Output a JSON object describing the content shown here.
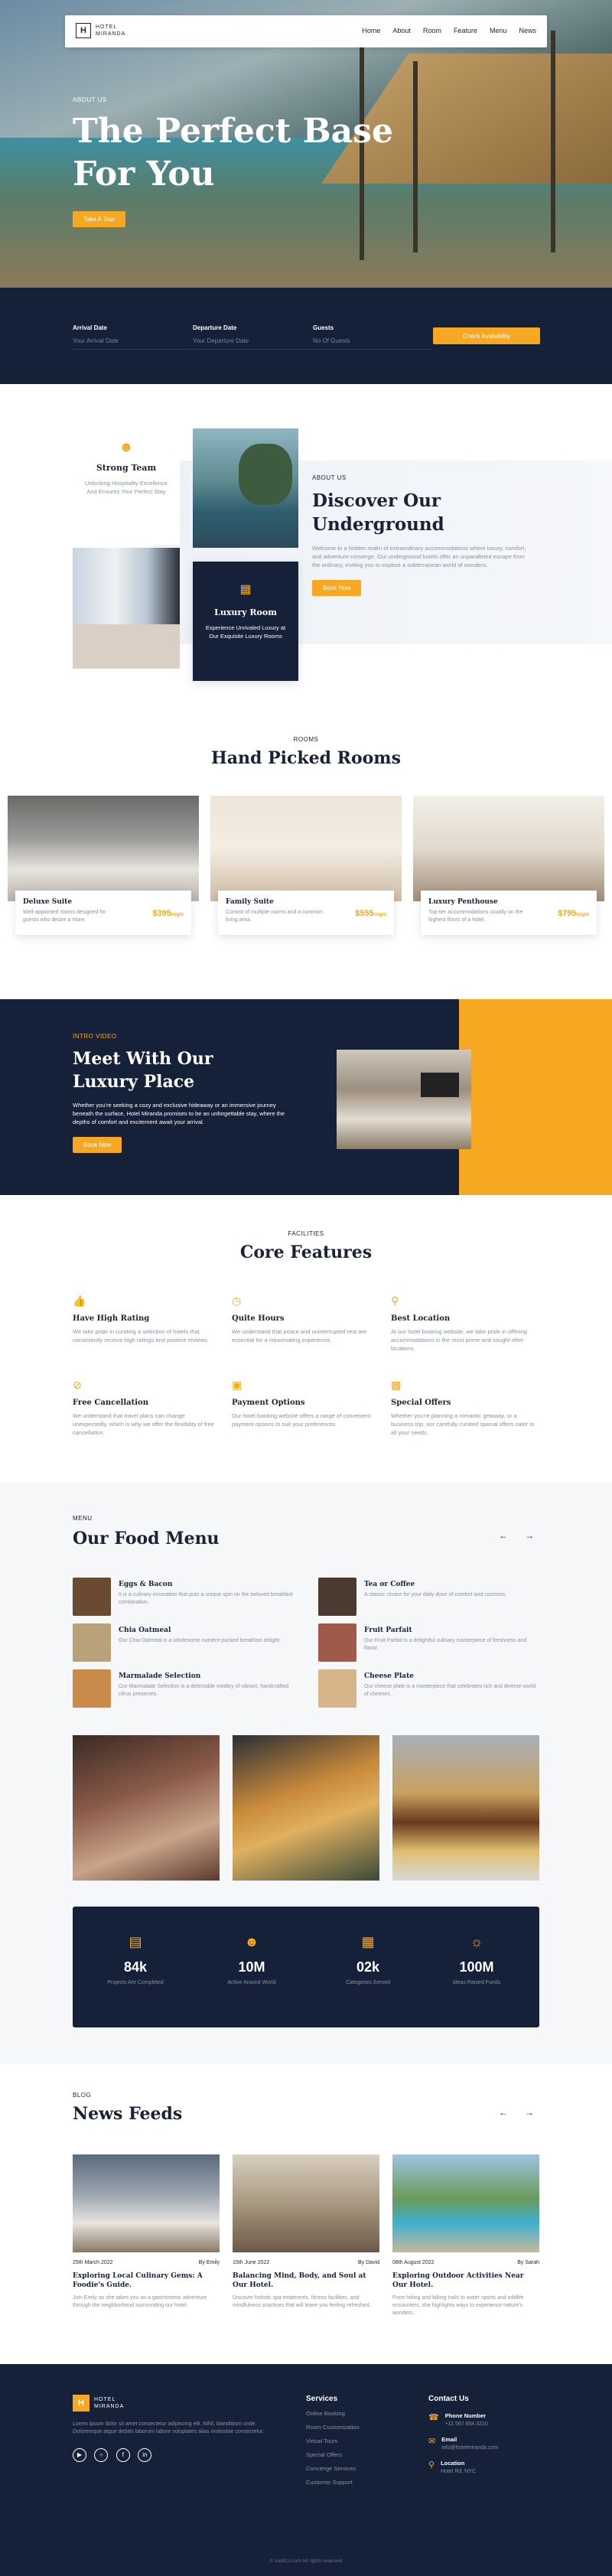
{
  "nav": {
    "brand": [
      "HOTEL",
      "MIRANDA"
    ],
    "logo_letter": "H",
    "links": [
      "Home",
      "About",
      "Room",
      "Feature",
      "Menu",
      "News"
    ]
  },
  "hero": {
    "eyebrow": "ABOUT US",
    "title": "The Perfect Base For You",
    "button": "Take A Tour"
  },
  "booking": {
    "fields": [
      {
        "label": "Arrival Date",
        "placeholder": "Your Arrival Date"
      },
      {
        "label": "Departure Date",
        "placeholder": "Your Departure Date"
      },
      {
        "label": "Guests",
        "placeholder": "No Of Guests"
      }
    ],
    "button": "Check Availability"
  },
  "about": {
    "team_title": "Strong Team",
    "team_desc": "Unlocking Hospitality Excellence And Ensures Your Perfect Stay",
    "room_title": "Luxury Room",
    "room_desc": "Experience Unrivaled Luxury at Our Exquisite Luxury Rooms",
    "eyebrow": "ABOUT US",
    "title": "Discover Our Underground",
    "desc": "Welcome to a hidden realm of extraordinary accommodations where luxury, comfort, and adventure converge. Our underground hotels offer an unparalleled escape from the ordinary, inviting you to explore a subterranean world of wonders.",
    "button": "Book Now"
  },
  "rooms": {
    "eyebrow": "ROOMS",
    "title": "Hand Picked Rooms",
    "items": [
      {
        "name": "Deluxe Suite",
        "desc": "Well-appointed rooms designed for guests who desire a more.",
        "price": "$395",
        "unit": "/night"
      },
      {
        "name": "Family Suite",
        "desc": "Consist of multiple rooms and a common living area.",
        "price": "$555",
        "unit": "/night"
      },
      {
        "name": "Luxury Penthouse",
        "desc": "Top-tier accommodations usually on the highest floors of a hotel.",
        "price": "$795",
        "unit": "/night"
      }
    ]
  },
  "intro": {
    "eyebrow": "INTRO VIDEO",
    "title": "Meet With Our Luxury Place",
    "desc": "Whether you're seeking a cozy and exclusive hideaway or an immersive journey beneath the surface, Hotel Miranda promises to be an unforgettable stay, where the depths of comfort and excitement await your arrival.",
    "button": "Book Now"
  },
  "features": {
    "eyebrow": "FACILITIES",
    "title": "Core Features",
    "items": [
      {
        "icon": "thumbs-up-icon",
        "title": "Have High Rating",
        "desc": "We take pride in curating a selection of hotels that consistently receive high ratings and positive reviews."
      },
      {
        "icon": "clock-icon",
        "title": "Quite Hours",
        "desc": "We understand that peace and uninterrupted rest are essential for a rejuvenating experience."
      },
      {
        "icon": "location-pin-icon",
        "title": "Best Location",
        "desc": "At our hotel booking website, we take pride in offering accommodations in the most prime and sought-after locations."
      },
      {
        "icon": "cancel-circle-icon",
        "title": "Free Cancellation",
        "desc": "We understand that travel plans can change unexpectedly, which is why we offer the flexibility of free cancellation."
      },
      {
        "icon": "credit-card-icon",
        "title": "Payment Options",
        "desc": "Our hotel booking website offers a range of convenient payment options to suit your preferences."
      },
      {
        "icon": "gift-icon",
        "title": "Special Offers",
        "desc": "Whether you're planning a romantic getaway, or a business trip, our carefully curated special offers cater to all your needs."
      }
    ]
  },
  "menu": {
    "eyebrow": "MENU",
    "title": "Our Food Menu",
    "items": [
      {
        "title": "Eggs & Bacon",
        "desc": "It is a culinary innovation that puts a unique spin on the beloved breakfast combination."
      },
      {
        "title": "Tea or Coffee",
        "desc": "A classic choice for your daily dose of comfort and coziness."
      },
      {
        "title": "Chia Oatmeal",
        "desc": "Our Chia Oatmeal is a wholesome nutrient-packed breakfast delight."
      },
      {
        "title": "Fruit Parfait",
        "desc": "Our Fruit Parfait is a delightful culinary masterpiece of freshness and flavor."
      },
      {
        "title": "Marmalade Selection",
        "desc": "Our Marmalade Selection is a delectable medley of vibrant, handcrafted citrus preserves."
      },
      {
        "title": "Cheese Plate",
        "desc": "Our cheese plate is a masterpiece that celebrates rich and diverse world of cheeses."
      }
    ]
  },
  "stats": [
    {
      "icon": "document-icon",
      "value": "84k",
      "label": "Projects Are Completed"
    },
    {
      "icon": "user-icon",
      "value": "10M",
      "label": "Active Around World"
    },
    {
      "icon": "grid-icon",
      "value": "02k",
      "label": "Categories Served"
    },
    {
      "icon": "lightbulb-icon",
      "value": "100M",
      "label": "Ideas Raised Funds"
    }
  ],
  "news": {
    "eyebrow": "BLOG",
    "title": "News Feeds",
    "items": [
      {
        "date": "25th March 2022",
        "author": "By Emily",
        "title": "Exploring Local Culinary Gems: A Foodie's Guide.",
        "desc": "Join Emily as she takes you on a gastronomic adventure through the neighborhood surrounding our hotel."
      },
      {
        "date": "15th June 2022",
        "author": "By David",
        "title": "Balancing Mind, Body, and Soul at Our Hotel.",
        "desc": "Discover holistic spa treatments, fitness facilities, and mindfulness practices that will leave you feeling refreshed."
      },
      {
        "date": "08th August 2022",
        "author": "By Sarah",
        "title": "Exploring Outdoor Activities Near Our Hotel.",
        "desc": "From hiking and biking trails to water sports and wildlife encounters, she highlights ways to experience nature's wonders."
      }
    ]
  },
  "footer": {
    "brand": [
      "HOTEL",
      "MIRANDA"
    ],
    "desc": "Lorem ipsum dolor sit amet consectetur adipiscing elit. Nihil, blanditiism unde. Doloremque atque debitis laborum labore voluptates alias molestiae consectetur.",
    "services_title": "Services",
    "services": [
      "Online Booking",
      "Room Customization",
      "Virtual Tours",
      "Special Offers",
      "Concierge Services",
      "Customer Support"
    ],
    "contact_title": "Contact Us",
    "phone_label": "Phone Number",
    "phone": "+11 567 654 3210",
    "email_label": "Email",
    "email": "info@hotelmiranda.com",
    "location_label": "Location",
    "location": "Hotel Rd, NYC",
    "copyright": "© codiCo.com All rights reserved"
  }
}
